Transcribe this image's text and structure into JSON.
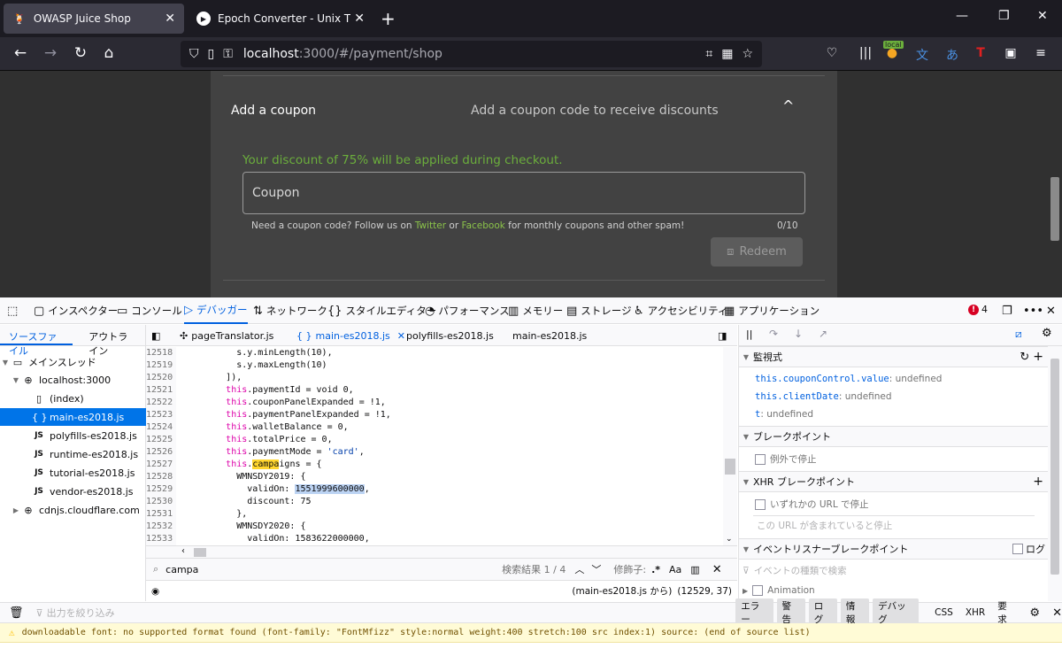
{
  "browser": {
    "tabs": [
      {
        "title": "OWASP Juice Shop",
        "active": true
      },
      {
        "title": "Epoch Converter - Unix Timesta",
        "active": false
      }
    ],
    "url_host": "localhost",
    "url_path": ":3000/#/payment/shop",
    "ext_badge": "local"
  },
  "page": {
    "coupon_title": "Add a coupon",
    "coupon_desc": "Add a coupon code to receive discounts",
    "discount_msg": "Your discount of 75% will be applied during checkout.",
    "coupon_placeholder": "Coupon",
    "hint_prefix": "Need a coupon code? Follow us on ",
    "hint_twitter": "Twitter",
    "hint_or": " or ",
    "hint_facebook": "Facebook",
    "hint_suffix": " for monthly coupons and other spam!",
    "char_count": "0/10",
    "redeem_label": "Redeem"
  },
  "devtools": {
    "tools": [
      "インスペクター",
      "コンソール",
      "デバッガー",
      "ネットワーク",
      "スタイルエディター",
      "パフォーマンス",
      "メモリー",
      "ストレージ",
      "アクセシビリティ",
      "アプリケーション"
    ],
    "error_count": "4",
    "source_tabs": [
      "ソースファイル",
      "アウトライン"
    ],
    "tree": {
      "main_thread": "メインスレッド",
      "host": "localhost:3000",
      "files": [
        "(index)",
        "main-es2018.js",
        "polyfills-es2018.js",
        "runtime-es2018.js",
        "tutorial-es2018.js",
        "vendor-es2018.js"
      ],
      "cdn": "cdnjs.cloudflare.com"
    },
    "editor_tabs": [
      "pageTranslator.js",
      "main-es2018.js",
      "polyfills-es2018.js",
      "main-es2018.js"
    ],
    "code_lines": [
      {
        "n": "12518",
        "indent": "          ",
        "text": "s.y.minLength(10),"
      },
      {
        "n": "12519",
        "indent": "          ",
        "text": "s.y.maxLength(10)"
      },
      {
        "n": "12520",
        "indent": "        ",
        "text": "]),"
      },
      {
        "n": "12521",
        "indent": "        ",
        "kw": "this",
        "text": ".paymentId = void 0,"
      },
      {
        "n": "12522",
        "indent": "        ",
        "kw": "this",
        "text": ".couponPanelExpanded = !1,"
      },
      {
        "n": "12523",
        "indent": "        ",
        "kw": "this",
        "text": ".paymentPanelExpanded = !1,"
      },
      {
        "n": "12524",
        "indent": "        ",
        "kw": "this",
        "text": ".walletBalance = 0,"
      },
      {
        "n": "12525",
        "indent": "        ",
        "kw": "this",
        "text": ".totalPrice = 0,"
      },
      {
        "n": "12526",
        "indent": "        ",
        "kw": "this",
        "text": ".paymentMode = ",
        "str": "'card'",
        "after": ","
      },
      {
        "n": "12527",
        "indent": "        ",
        "kw": "this",
        "text": ".",
        "hl": "campa",
        "after": "igns = {"
      },
      {
        "n": "12528",
        "indent": "          ",
        "text": "WMNSDY2019: {"
      },
      {
        "n": "12529",
        "indent": "            ",
        "text": "validOn: ",
        "hl2": "1551999600000",
        "after": ","
      },
      {
        "n": "12530",
        "indent": "            ",
        "text": "discount: 75"
      },
      {
        "n": "12531",
        "indent": "          ",
        "text": "},"
      },
      {
        "n": "12532",
        "indent": "          ",
        "text": "WMNSDY2020: {"
      },
      {
        "n": "12533",
        "indent": "            ",
        "text": "validOn: 1583622000000,"
      },
      {
        "n": "12534",
        "indent": "",
        "text": ""
      }
    ],
    "search_value": "campa",
    "search_result": "検索結果 1 / 4",
    "modifiers_label": "修飾子:",
    "status_text": "(main-es2018.js から)",
    "status_pos": "(12529, 37)",
    "watch_header": "監視式",
    "watches": [
      {
        "name": "this.couponControl.value",
        "value": "undefined"
      },
      {
        "name": "this.clientDate",
        "value": "undefined"
      },
      {
        "name": "t",
        "value": "undefined"
      }
    ],
    "breakpoints_header": "ブレークポイント",
    "pause_exceptions": "例外で停止",
    "xhr_header": "XHR ブレークポイント",
    "xhr_any": "いずれかの URL で停止",
    "xhr_placeholder": "この URL が含まれていると停止",
    "event_header": "イベントリスナーブレークポイント",
    "event_log": "ログ",
    "event_filter_placeholder": "イベントの種類で検索",
    "event_first": "Animation",
    "console_filter_placeholder": "出力を絞り込み",
    "console_filters": [
      "エラー",
      "警告",
      "ログ",
      "情報",
      "デバッグ"
    ],
    "console_plain": [
      "CSS",
      "XHR",
      "要求"
    ],
    "console_warning": "downloadable font: no supported format found (font-family: \"FontMfizz\" style:normal weight:400 stretch:100 src index:1) source: (end of source list)"
  },
  "colors": {
    "accent": "#0060df",
    "discount_green": "#6bae3c",
    "page_bg": "#303030",
    "card_bg": "#424242"
  }
}
